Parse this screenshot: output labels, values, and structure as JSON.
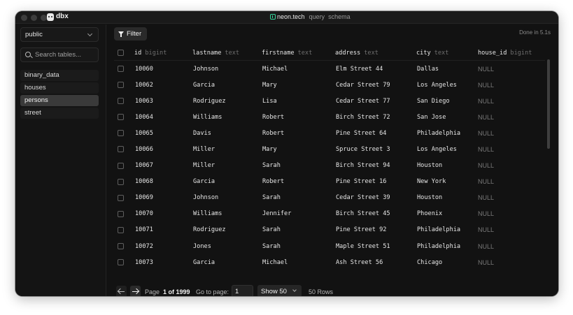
{
  "app": {
    "name": "dbx"
  },
  "titlebar": {
    "host": "neon.tech",
    "tabs": [
      "query",
      "schema"
    ]
  },
  "sidebar": {
    "schema": "public",
    "search_placeholder": "Search tables...",
    "tables": [
      "binary_data",
      "houses",
      "persons",
      "street"
    ],
    "active_table": "persons"
  },
  "toolbar": {
    "filter_label": "Filter",
    "status": "Done in 5.1s"
  },
  "table": {
    "columns": [
      {
        "name": "id",
        "type": "bigint"
      },
      {
        "name": "lastname",
        "type": "text"
      },
      {
        "name": "firstname",
        "type": "text"
      },
      {
        "name": "address",
        "type": "text"
      },
      {
        "name": "city",
        "type": "text"
      },
      {
        "name": "house_id",
        "type": "bigint"
      }
    ],
    "rows": [
      [
        "10060",
        "Johnson",
        "Michael",
        "Elm Street 44",
        "Dallas",
        "NULL"
      ],
      [
        "10062",
        "Garcia",
        "Mary",
        "Cedar Street 79",
        "Los Angeles",
        "NULL"
      ],
      [
        "10063",
        "Rodriguez",
        "Lisa",
        "Cedar Street 77",
        "San Diego",
        "NULL"
      ],
      [
        "10064",
        "Williams",
        "Robert",
        "Birch Street 72",
        "San Jose",
        "NULL"
      ],
      [
        "10065",
        "Davis",
        "Robert",
        "Pine Street 64",
        "Philadelphia",
        "NULL"
      ],
      [
        "10066",
        "Miller",
        "Mary",
        "Spruce Street 3",
        "Los Angeles",
        "NULL"
      ],
      [
        "10067",
        "Miller",
        "Sarah",
        "Birch Street 94",
        "Houston",
        "NULL"
      ],
      [
        "10068",
        "Garcia",
        "Robert",
        "Pine Street 16",
        "New York",
        "NULL"
      ],
      [
        "10069",
        "Johnson",
        "Sarah",
        "Cedar Street 39",
        "Houston",
        "NULL"
      ],
      [
        "10070",
        "Williams",
        "Jennifer",
        "Birch Street 45",
        "Phoenix",
        "NULL"
      ],
      [
        "10071",
        "Rodriguez",
        "Sarah",
        "Pine Street 92",
        "Philadelphia",
        "NULL"
      ],
      [
        "10072",
        "Jones",
        "Sarah",
        "Maple Street 51",
        "Philadelphia",
        "NULL"
      ],
      [
        "10073",
        "Garcia",
        "Michael",
        "Ash Street 56",
        "Chicago",
        "NULL"
      ]
    ]
  },
  "pagination": {
    "page_label": "Page",
    "page_of": "1 of 1999",
    "goto_label": "Go to page:",
    "goto_value": "1",
    "show_value": "Show 50",
    "rows_label": "50 Rows"
  }
}
